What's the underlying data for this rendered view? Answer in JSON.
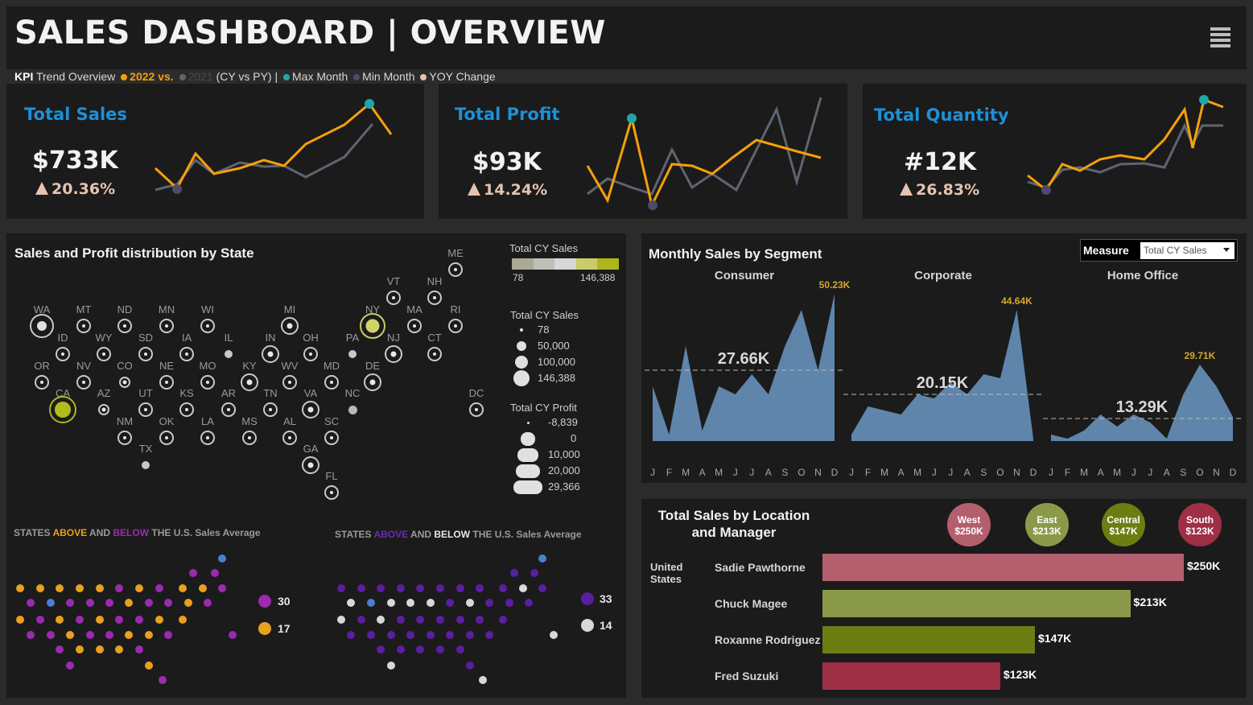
{
  "header": {
    "title": "SALES DASHBOARD | OVERVIEW"
  },
  "legend": {
    "kpi": "KPI",
    "trend": "Trend Overview",
    "cy": "2022 vs.",
    "py": "2021",
    "cy_vs_py": "(CY vs PY) |",
    "max_month": "Max Month",
    "min_month": "Min Month",
    "yoy": "YOY Change"
  },
  "colors": {
    "cy_line": "#f5a10a",
    "py_line": "#5f6470",
    "max_dot": "#1fa7a8",
    "min_dot": "#4d4a6b",
    "yoy": "#e6c3b0",
    "kpi_title": "#1e90d6",
    "area": "#5f85ab",
    "west": "#b45f6e",
    "east": "#8a9a4a",
    "central": "#6b7e12",
    "south": "#9e2f45",
    "above": "#e8a020",
    "below": "#9b2ab0",
    "dark_purple": "#5a1fa0"
  },
  "kpis": [
    {
      "title": "Total Sales",
      "value": "$733K",
      "change": "20.36%"
    },
    {
      "title": "Total Profit",
      "value": "$93K",
      "change": "14.24%"
    },
    {
      "title": "Total Quantity",
      "value": "#12K",
      "change": "26.83%"
    }
  ],
  "map": {
    "title": "Sales and Profit distribution by State",
    "states": [
      "ME",
      "VT",
      "NH",
      "WA",
      "MT",
      "ND",
      "MN",
      "WI",
      "MI",
      "NY",
      "MA",
      "RI",
      "ID",
      "WY",
      "SD",
      "IA",
      "IL",
      "IN",
      "OH",
      "PA",
      "NJ",
      "CT",
      "OR",
      "NV",
      "CO",
      "NE",
      "MO",
      "KY",
      "WV",
      "MD",
      "DE",
      "CA",
      "AZ",
      "UT",
      "KS",
      "AR",
      "TN",
      "VA",
      "NC",
      "DC",
      "NM",
      "OK",
      "LA",
      "MS",
      "AL",
      "SC",
      "GA",
      "TX",
      "FL"
    ],
    "color_legend": {
      "title": "Total CY Sales",
      "min": "78",
      "max": "146,388"
    },
    "size_legend": {
      "title": "Total CY Sales",
      "values": [
        "78",
        "50,000",
        "100,000",
        "146,388"
      ]
    },
    "profit_legend": {
      "title": "Total CY Profit",
      "values": [
        "-8,839",
        "0",
        "10,000",
        "20,000",
        "29,366"
      ]
    }
  },
  "states_compare": {
    "left": {
      "p1": "STATES",
      "above": "ABOVE",
      "p2": "AND",
      "below": "BELOW",
      "p3": "THE U.S. Sales Average",
      "count_below": "30",
      "count_above": "17"
    },
    "right": {
      "p1": "STATES",
      "above": "ABOVE",
      "p2": "AND",
      "below": "BELOW",
      "p3": "THE U.S. Sales Average",
      "count_purple": "33",
      "count_white": "14"
    }
  },
  "monthly": {
    "title": "Monthly Sales by Segment",
    "measure_label": "Measure",
    "measure_value": "Total CY Sales",
    "months": [
      "J",
      "F",
      "M",
      "A",
      "M",
      "J",
      "J",
      "A",
      "S",
      "O",
      "N",
      "D"
    ],
    "segments": [
      {
        "name": "Consumer",
        "avg": "27.66K",
        "peak": "50.23K"
      },
      {
        "name": "Corporate",
        "avg": "20.15K",
        "peak": "44.64K"
      },
      {
        "name": "Home Office",
        "avg": "13.29K",
        "peak": "29.71K"
      }
    ]
  },
  "location": {
    "title1": "Total Sales by Location",
    "title2": "and Manager",
    "country1": "United",
    "country2": "States",
    "regions": [
      {
        "name": "West",
        "value": "$250K"
      },
      {
        "name": "East",
        "value": "$213K"
      },
      {
        "name": "Central",
        "value": "$147K"
      },
      {
        "name": "South",
        "value": "$123K"
      }
    ],
    "managers": [
      {
        "name": "Sadie Pawthorne",
        "value": "$250K",
        "amount": 250
      },
      {
        "name": "Chuck Magee",
        "value": "$213K",
        "amount": 213
      },
      {
        "name": "Roxanne Rodriguez",
        "value": "$147K",
        "amount": 147
      },
      {
        "name": "Fred Suzuki",
        "value": "$123K",
        "amount": 123
      }
    ]
  }
}
